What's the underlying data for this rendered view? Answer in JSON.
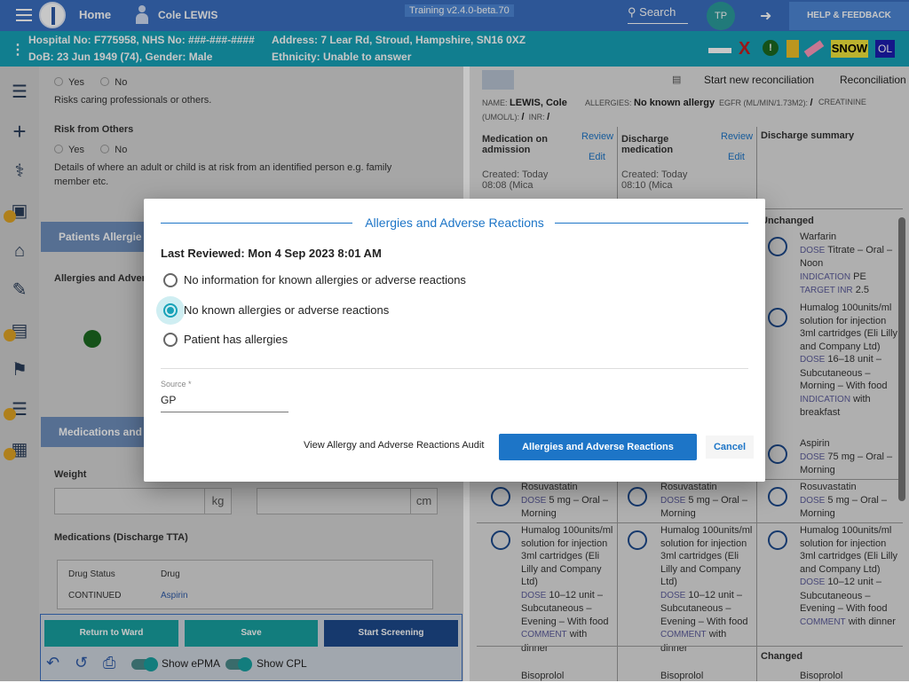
{
  "topbar": {
    "home": "Home",
    "user_name": "Cole LEWIS",
    "version": "Training v2.4.0-beta.70",
    "search": "Search",
    "avatar": "TP",
    "help": "HELP & FEEDBACK"
  },
  "patient": {
    "ids": "Hospital No: F775958, NHS No: ###-###-####",
    "dob": "DoB: 23 Jun 1949 (74), Gender: Male",
    "address": "Address: 7 Lear Rd, Stroud, Hampshire, SN16 0XZ",
    "ethnicity": "Ethnicity: Unable to answer",
    "flags": {
      "snow": "SNOW",
      "ol": "OL",
      "x": "X",
      "alert": "!"
    }
  },
  "left": {
    "yes": "Yes",
    "no": "No",
    "risk_caring": "Risks caring professionals or others.",
    "risk_from_others_title": "Risk from Others",
    "risk_from_others_desc1": "Details of where an adult or child is at risk from an identified person e.g. family",
    "risk_from_others_desc2": "member etc.",
    "patients_allergies": "Patients Allergie",
    "allergies_label": "Allergies and Advers",
    "med_section": "Medications and",
    "weight": "Weight",
    "kg": "kg",
    "cm": "cm",
    "meds_discharge": "Medications (Discharge TTA)",
    "drug_status": "Drug Status",
    "drug": "Drug",
    "continued": "CONTINUED",
    "aspirin": "Aspirin"
  },
  "bottom": {
    "return": "Return to Ward",
    "save": "Save",
    "start_screening": "Start Screening",
    "show_epma": "Show ePMA",
    "show_cpl": "Show CPL"
  },
  "right": {
    "start_reconciliation": "Start new reconciliation",
    "reconciliation_s": "Reconciliation s",
    "name_lbl": "NAME:",
    "name_val": "LEWIS, Cole",
    "allergies_lbl": "ALLERGIES:",
    "allergies_val": "No known allergy",
    "egfr": "EGFR (ML/MIN/1.73M2):",
    "egfr_val": "/",
    "creatinine": "CREATININE",
    "umol": "(UMOL/L):",
    "umol_val": "/",
    "inr": "INR:",
    "inr_val": "/",
    "col1_title": "Medication on admission",
    "col2_title": "Discharge medication",
    "col3_title": "Discharge summary",
    "review": "Review",
    "edit": "Edit",
    "created1": "Created: Today 08:08 (Mica",
    "created2": "Created: Today 08:10 (Mica",
    "unchanged": "Unchanged",
    "changed": "Changed",
    "warfarin": "Warfarin",
    "warfarin_dose_k": "DOSE",
    "warfarin_dose": "Titrate – Oral – Noon",
    "indication_k": "INDICATION",
    "warfarin_ind": "PE",
    "target_k": "TARGET INR",
    "warfarin_target": "2.5",
    "humalog": "Humalog 100units/ml solution for injection 3ml cartridges (Eli Lilly and Company Ltd)",
    "humalog_dose1": "16–18 unit – Subcutaneous – Morning – With food",
    "humalog_ind": "with breakfast",
    "aspirin": "Aspirin",
    "aspirin_dose": "75 mg – Oral – Morning",
    "rosuvastatin": "Rosuvastatin",
    "rosu_dose": "5 mg – Oral – Morning",
    "humalog2_dose": "10–12 unit – Subcutaneous – Evening – With food",
    "comment_k": "COMMENT",
    "comment": "with dinner",
    "bisoprolol": "Bisoprolol"
  },
  "modal": {
    "title": "Allergies and Adverse Reactions",
    "last_reviewed": "Last Reviewed: Mon 4 Sep 2023 8:01 AM",
    "options": [
      "No information for known allergies or adverse reactions",
      "No known allergies or adverse reactions",
      "Patient has allergies"
    ],
    "selected": 1,
    "source_label": "Source *",
    "source_value": "GP",
    "audit": "View Allergy and Adverse Reactions Audit",
    "reviewed_btn": "Allergies and Adverse Reactions Reviewed",
    "cancel": "Cancel"
  }
}
